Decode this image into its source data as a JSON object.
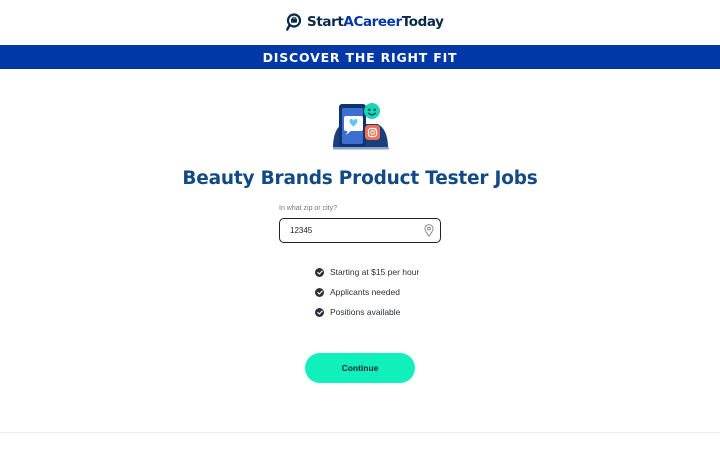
{
  "header": {
    "logo_part1": "Start",
    "logo_part2": "ACareer",
    "logo_part3": "Today",
    "logo_icon": "magnifier-briefcase-icon"
  },
  "banner": {
    "text": "DISCOVER THE RIGHT FIT"
  },
  "hero": {
    "icon": "phone-chat-illustration"
  },
  "page": {
    "title": "Beauty Brands Product Tester Jobs"
  },
  "zip": {
    "label": "In what zip or city?",
    "value": "12345",
    "icon": "location-pin-icon"
  },
  "benefits": [
    {
      "text": "Starting at $15 per hour"
    },
    {
      "text": "Applicants needed"
    },
    {
      "text": "Positions available"
    }
  ],
  "cta": {
    "label": "Continue"
  },
  "colors": {
    "brand_blue": "#0038a8",
    "title_blue": "#114a85",
    "accent_mint": "#0ff0bc"
  }
}
